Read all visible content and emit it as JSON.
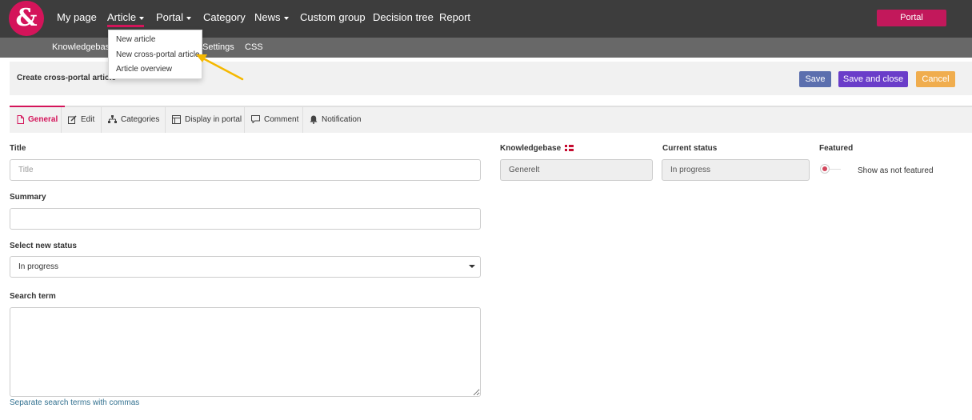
{
  "logo": {
    "glyph": "&"
  },
  "nav": {
    "items": [
      {
        "label": "My page"
      },
      {
        "label": "Article"
      },
      {
        "label": "Portal"
      },
      {
        "label": "Category"
      },
      {
        "label": "News"
      },
      {
        "label": "Custom group"
      },
      {
        "label": "Decision tree"
      },
      {
        "label": "Report"
      }
    ],
    "portal_button": "Portal"
  },
  "subnav": {
    "items": [
      {
        "label": "Knowledgebase"
      },
      {
        "label": "Settings"
      },
      {
        "label": "CSS"
      }
    ]
  },
  "article_menu": {
    "items": [
      {
        "label": "New article"
      },
      {
        "label": "New cross-portal article"
      },
      {
        "label": "Article overview"
      }
    ]
  },
  "header": {
    "title": "Create cross-portal article",
    "save": "Save",
    "save_close": "Save and close",
    "cancel": "Cancel"
  },
  "tabs": [
    {
      "label": "General",
      "icon": "file-icon"
    },
    {
      "label": "Edit",
      "icon": "edit-icon"
    },
    {
      "label": "Categories",
      "icon": "sitemap-icon"
    },
    {
      "label": "Display in portal",
      "icon": "portal-icon"
    },
    {
      "label": "Comment",
      "icon": "comment-icon"
    },
    {
      "label": "Notification",
      "icon": "bell-icon"
    }
  ],
  "form": {
    "title_label": "Title",
    "title_placeholder": "Title",
    "summary_label": "Summary",
    "status_label": "Select new status",
    "status_value": "In progress",
    "search_label": "Search term",
    "search_hint": "Separate search terms with commas",
    "knowledgebase_label": "Knowledgebase",
    "knowledgebase_value": "Generelt",
    "current_status_label": "Current status",
    "current_status_value": "In progress",
    "featured_label": "Featured",
    "featured_text": "Show as not featured"
  },
  "colors": {
    "brand": "#d4145a",
    "save": "#5b6fae",
    "save_close": "#6a3dc9",
    "cancel": "#f0ad4e",
    "annotation_arrow": "#f5b800"
  }
}
